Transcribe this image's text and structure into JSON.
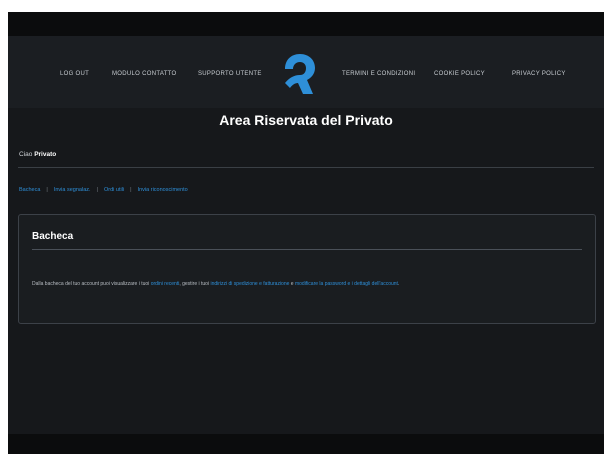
{
  "nav": {
    "left_links": [
      "LOG OUT",
      "MODULO CONTATTO",
      "SUPPORTO UTENTE"
    ],
    "right_links": [
      "TERMINI E CONDIZIONI",
      "COOKIE POLICY",
      "PRIVACY POLICY"
    ]
  },
  "page_title": "Area Riservata del Privato",
  "greeting": {
    "prefix": "Ciao",
    "name": "Privato"
  },
  "tabs": [
    "Bacheca",
    "Invia segnalaz.",
    "Ordi utili",
    "Invia riconoscimento"
  ],
  "bacheca": {
    "title": "Bacheca",
    "text_before": "Dalla bacheca del tuo account puoi visualizzare i tuoi",
    "link1": "ordini recenti",
    "text_middle": ", gestire i tuoi",
    "link2": "indirizzi di spedizione e fatturazione",
    "text_and": "e",
    "link3": "modificare la password e i dettagli dell'account",
    "text_after": "."
  },
  "colors": {
    "accent": "#2e8fd8",
    "background": "#16181b",
    "nav": "#1b1e22"
  }
}
